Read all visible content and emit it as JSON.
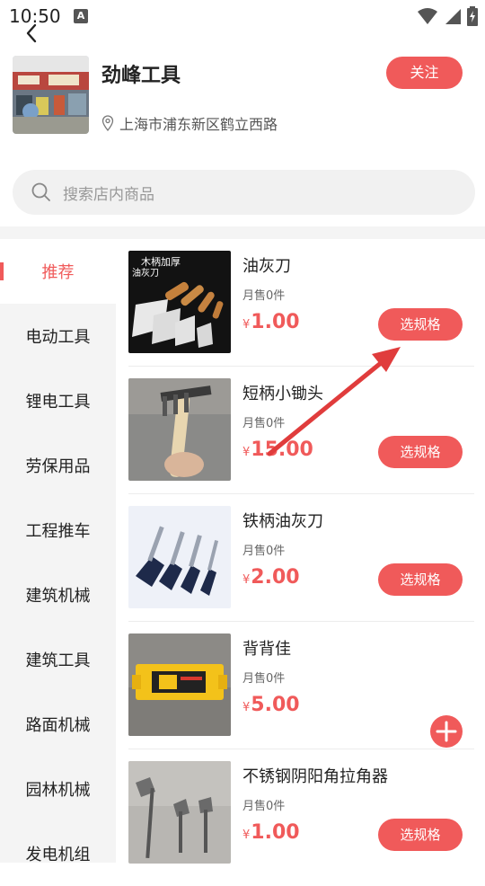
{
  "status_bar": {
    "time": "10:50",
    "notification_icon_letter": "A"
  },
  "header": {
    "store_name": "劲峰工具",
    "address": "上海市浦东新区鹤立西路",
    "follow_label": "关注"
  },
  "search": {
    "placeholder": "搜索店内商品"
  },
  "sidebar": {
    "items": [
      {
        "label": "推荐",
        "active": true
      },
      {
        "label": "电动工具"
      },
      {
        "label": "锂电工具"
      },
      {
        "label": "劳保用品"
      },
      {
        "label": "工程推车"
      },
      {
        "label": "建筑机械"
      },
      {
        "label": "建筑工具"
      },
      {
        "label": "路面机械"
      },
      {
        "label": "园林机械"
      },
      {
        "label": "发电机组"
      }
    ]
  },
  "products": [
    {
      "name": "油灰刀",
      "sales": "月售0件",
      "currency": "¥",
      "price": "1.00",
      "action": "选规格",
      "image_caption_1": "木柄加厚",
      "image_caption_2": "油灰刀"
    },
    {
      "name": "短柄小锄头",
      "sales": "月售0件",
      "currency": "¥",
      "price": "15.00",
      "action": "选规格"
    },
    {
      "name": "铁柄油灰刀",
      "sales": "月售0件",
      "currency": "¥",
      "price": "2.00",
      "action": "选规格"
    },
    {
      "name": "背背佳",
      "sales": "月售0件",
      "currency": "¥",
      "price": "5.00",
      "action": "add"
    },
    {
      "name": "不锈钢阴阳角拉角器",
      "sales": "月售0件",
      "currency": "¥",
      "price": "1.00",
      "action": "选规格"
    }
  ],
  "colors": {
    "accent": "#f05a5a",
    "sidebar_bg": "#f4f4f4",
    "search_bg": "#f1f1f1",
    "annotation_arrow": "#e03c3c"
  },
  "icons": {
    "back": "chevron-left-icon",
    "search": "search-icon",
    "location": "location-pin-icon",
    "wifi": "wifi-icon",
    "signal": "signal-icon",
    "battery": "battery-icon",
    "add": "plus-circle-icon"
  }
}
